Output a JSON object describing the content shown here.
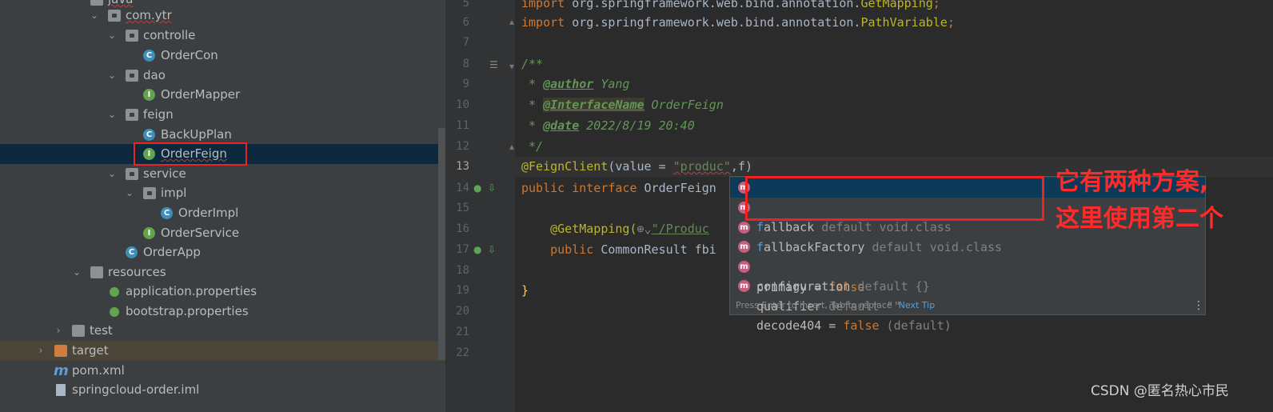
{
  "tree": {
    "items": [
      {
        "label": "java",
        "kind": "folder"
      },
      {
        "label": "com.ytr",
        "kind": "folder"
      },
      {
        "label": "controlle",
        "kind": "folder"
      },
      {
        "label": "OrderCon",
        "kind": "class"
      },
      {
        "label": "dao",
        "kind": "folder"
      },
      {
        "label": "OrderMapper",
        "kind": "interface"
      },
      {
        "label": "feign",
        "kind": "folder"
      },
      {
        "label": "BackUpPlan",
        "kind": "class"
      },
      {
        "label": "OrderFeign",
        "kind": "interface"
      },
      {
        "label": "service",
        "kind": "folder"
      },
      {
        "label": "impl",
        "kind": "folder"
      },
      {
        "label": "OrderImpl",
        "kind": "class"
      },
      {
        "label": "OrderService",
        "kind": "interface"
      },
      {
        "label": "OrderApp",
        "kind": "spring-class"
      },
      {
        "label": "resources",
        "kind": "folder"
      },
      {
        "label": "application.properties",
        "kind": "properties"
      },
      {
        "label": "bootstrap.properties",
        "kind": "properties"
      },
      {
        "label": "test",
        "kind": "folder"
      },
      {
        "label": "target",
        "kind": "folder"
      },
      {
        "label": "pom.xml",
        "kind": "maven"
      },
      {
        "label": "springcloud-order.iml",
        "kind": "iml"
      }
    ],
    "icons": {
      "class": "C",
      "interface": "I"
    }
  },
  "gutter": {
    "lines": [
      "5",
      "6",
      "7",
      "8",
      "9",
      "10",
      "11",
      "12",
      "13",
      "14",
      "15",
      "16",
      "17",
      "18",
      "19",
      "20",
      "21",
      "22"
    ],
    "current": "13"
  },
  "code": {
    "l5_kw": "import ",
    "l5_pkg": "org.springframework.web.bind.annotation.",
    "l5_cls": "GetMapping",
    "l6_kw": "import ",
    "l6_pkg": "org.springframework.web.bind.annotation.",
    "l6_cls": "PathVariable",
    "semi": ";",
    "l8": "/**",
    "l9_pre": " * ",
    "l9_tag": "@author",
    "l9_val": " Yang",
    "l10_pre": " * ",
    "l10_tag": "@InterfaceName",
    "l10_val": " OrderFeign",
    "l11_pre": " * ",
    "l11_tag": "@date",
    "l11_val": " 2022/8/19 20:40",
    "l12": " */",
    "l13_ann": "@FeignClient",
    "l13_a": "(value = ",
    "l13_str": "\"produc\"",
    "l13_b": ",f)",
    "l14_kw": "public interface ",
    "l14_name": "OrderFeign",
    "l16_ann": "@GetMapping(",
    "l16_str": "\"/Produc",
    "l17_kw": "public ",
    "l17_rest": "CommonResult fbi",
    "l19": "}"
  },
  "popup": {
    "icon_letter": "m",
    "items": [
      {
        "name": "fallback",
        "type": " default void.class"
      },
      {
        "name": "fallbackFactory",
        "type": " default void.class"
      },
      {
        "name": "primary = ",
        "value_kw": "false",
        "type": ""
      },
      {
        "name": "configuration",
        "type": " default {}"
      },
      {
        "name": "qualifier",
        "type": " default \"\""
      },
      {
        "name": "decode404 = ",
        "value_kw": "false",
        "type": " (default)"
      }
    ],
    "footer": "Press Enter to insert, Tab to replace",
    "next_tip": "Next Tip",
    "menu": "⋮"
  },
  "annotation_note": {
    "line1": "它有两种方案,",
    "line2": "这里使用第二个"
  },
  "watermark": "CSDN @匿名热心市民"
}
